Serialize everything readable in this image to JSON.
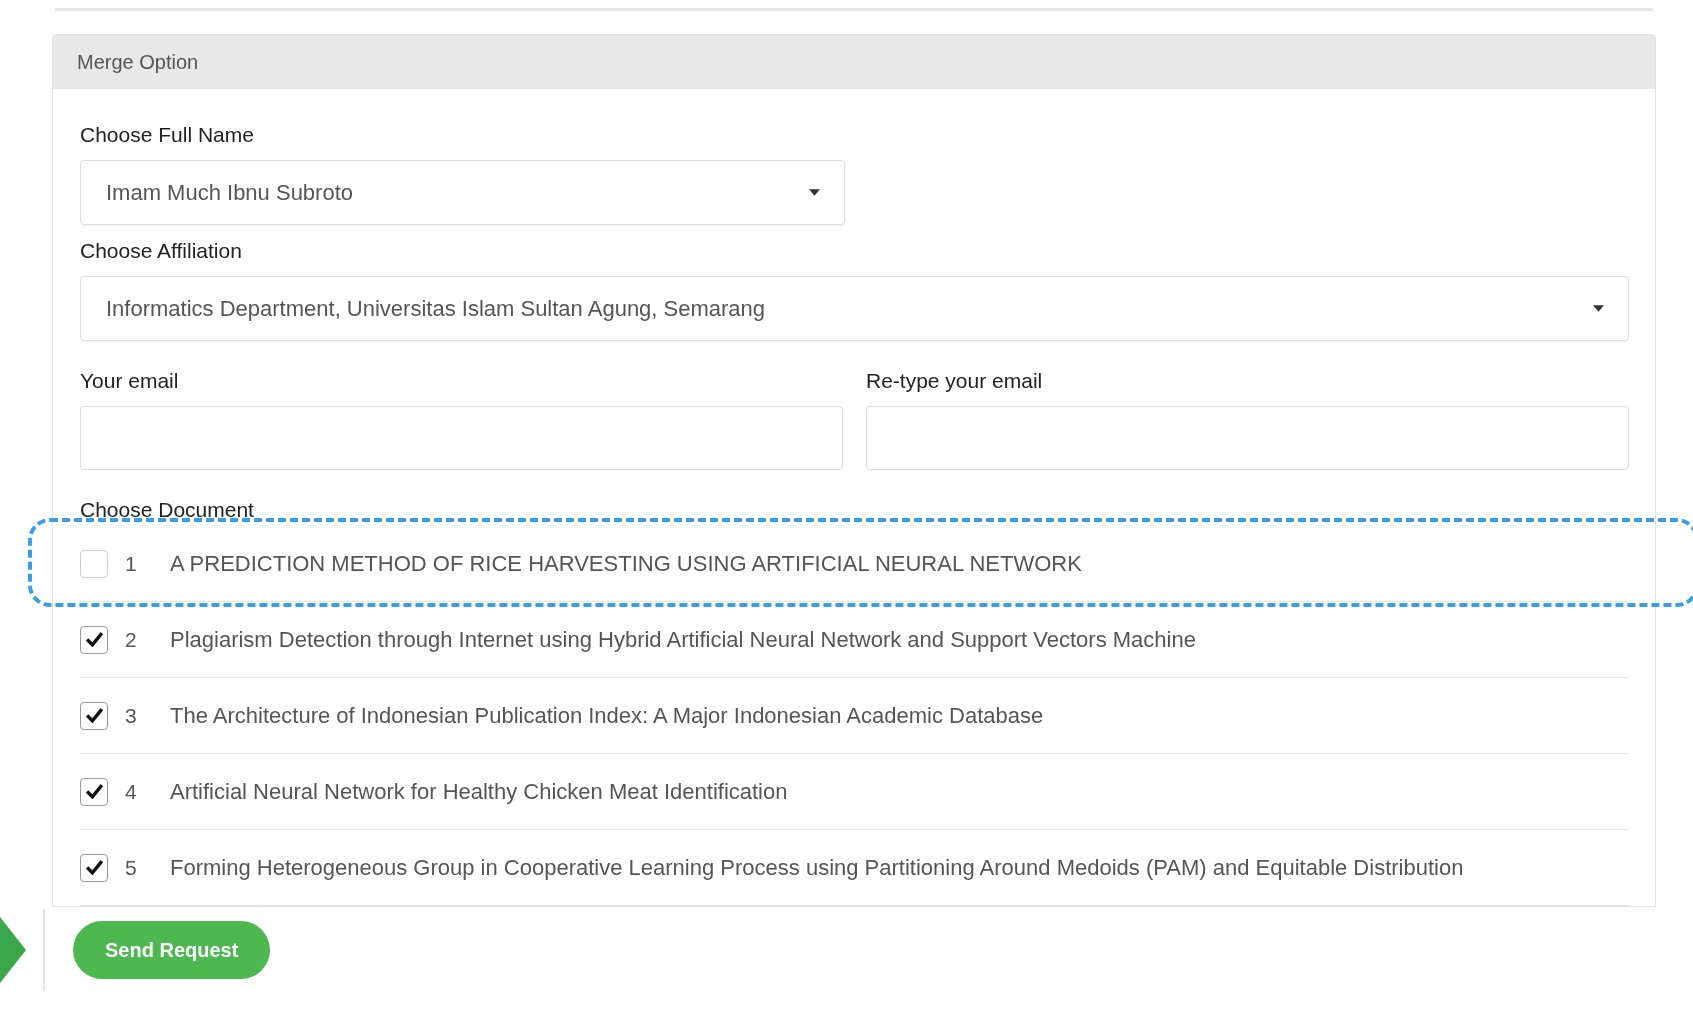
{
  "panel": {
    "title": "Merge Option"
  },
  "full_name": {
    "label": "Choose Full Name",
    "value": "Imam Much Ibnu Subroto"
  },
  "affiliation": {
    "label": "Choose Affiliation",
    "value": "Informatics Department, Universitas Islam Sultan Agung, Semarang"
  },
  "email": {
    "label": "Your email"
  },
  "retype_email": {
    "label": "Re-type your email"
  },
  "documents": {
    "label": "Choose Document",
    "items": [
      {
        "number": "1",
        "title": "A PREDICTION METHOD OF RICE HARVESTING USING ARTIFICIAL NEURAL NETWORK",
        "checked": false,
        "highlighted": true
      },
      {
        "number": "2",
        "title": "Plagiarism Detection through Internet using Hybrid Artificial Neural Network and Support Vectors Machine",
        "checked": true,
        "highlighted": false
      },
      {
        "number": "3",
        "title": "The Architecture of Indonesian Publication Index: A Major Indonesian Academic Database",
        "checked": true,
        "highlighted": false
      },
      {
        "number": "4",
        "title": "Artificial Neural Network for Healthy Chicken Meat Identification",
        "checked": true,
        "highlighted": false
      },
      {
        "number": "5",
        "title": "Forming Heterogeneous Group in Cooperative Learning Process using Partitioning Around Medoids (PAM) and Equitable Distribution",
        "checked": true,
        "highlighted": false
      }
    ]
  },
  "send_button": {
    "label": "Send Request"
  }
}
